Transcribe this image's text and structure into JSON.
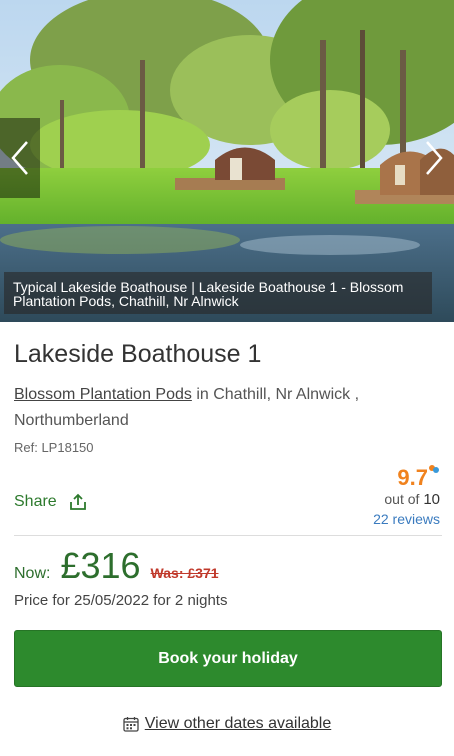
{
  "gallery": {
    "caption": "Typical Lakeside Boathouse | Lakeside Boathouse 1 - Blossom Plantation Pods, Chathill, Nr Alnwick",
    "prev_icon": "chevron-left-icon",
    "next_icon": "chevron-right-icon"
  },
  "property": {
    "title": "Lakeside Boathouse 1",
    "park_link": "Blossom Plantation Pods",
    "location_text": " in Chathill, Nr Alnwick , Northumberland",
    "ref": "Ref: LP18150"
  },
  "share": {
    "label": "Share",
    "icon": "share-icon"
  },
  "rating": {
    "score": "9.7",
    "out_of_prefix": "out of",
    "out_of_value": "10",
    "reviews": "22 reviews",
    "badge_icon": "balloon-icon"
  },
  "pricing": {
    "now_label": "Now:",
    "now_price": "£316",
    "was_price": "Was: £371",
    "price_for": "Price for 25/05/2022 for 2 nights"
  },
  "actions": {
    "book_label": "Book your holiday",
    "other_dates_label": "View other dates available",
    "calendar_icon": "calendar-icon"
  },
  "colors": {
    "primary_green": "#2d8a2d",
    "price_green": "#2d6e2d",
    "rating_orange": "#f0821e",
    "link_blue": "#3a7bbf",
    "was_red": "#c0392b"
  }
}
